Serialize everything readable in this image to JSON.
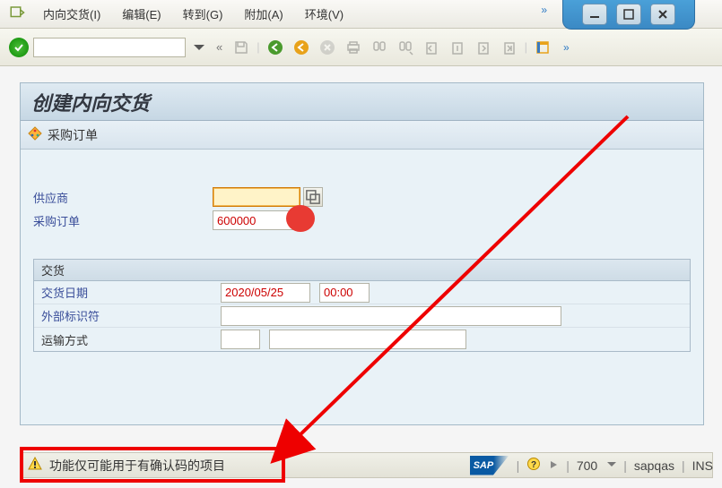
{
  "menu": {
    "items": [
      {
        "label": "内向交货(I)"
      },
      {
        "label": "编辑(E)"
      },
      {
        "label": "转到(G)"
      },
      {
        "label": "附加(A)"
      },
      {
        "label": "环境(V)"
      }
    ],
    "expand": "»"
  },
  "toolbar": {
    "command_value": "",
    "back_glyph": "«",
    "expand": "»"
  },
  "page": {
    "title": "创建内向交货",
    "subbar_label": "采购订单"
  },
  "form": {
    "vendor_label": "供应商",
    "vendor_value": "",
    "po_label": "采购订单",
    "po_value": "600000"
  },
  "delivery": {
    "group_title": "交货",
    "date_label": "交货日期",
    "date_value": "2020/05/25",
    "time_value": "00:00",
    "extid_label": "外部标识符",
    "extid_value": "",
    "transport_label": "运输方式",
    "transport_code": "",
    "transport_desc": ""
  },
  "status": {
    "message": "功能仅可能用于有确认码的项目",
    "sap": "SAP",
    "client": "700",
    "system": "sapqas",
    "mode": "INS"
  },
  "chart_data": null
}
